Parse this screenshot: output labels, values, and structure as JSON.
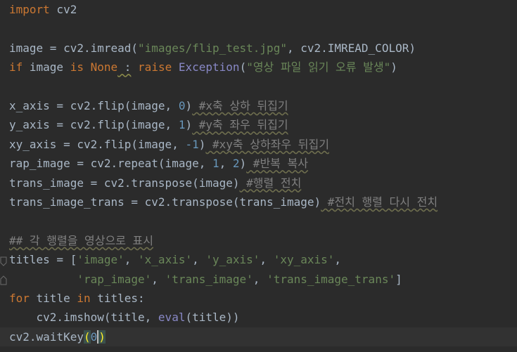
{
  "editor": {
    "lines": [
      {
        "tokens": [
          {
            "t": "import",
            "c": "kw"
          },
          {
            "t": " cv2",
            "c": ""
          }
        ]
      },
      {
        "tokens": []
      },
      {
        "tokens": [
          {
            "t": "image = cv2.imread(",
            "c": ""
          },
          {
            "t": "\"images/flip_test.jpg\"",
            "c": "str"
          },
          {
            "t": ", cv2.IMREAD_COLOR)",
            "c": ""
          }
        ]
      },
      {
        "tokens": [
          {
            "t": "if",
            "c": "kw"
          },
          {
            "t": " image ",
            "c": ""
          },
          {
            "t": "is",
            "c": "kw"
          },
          {
            "t": " ",
            "c": ""
          },
          {
            "t": "None",
            "c": "kw"
          },
          {
            "t": " :",
            "c": "warn"
          },
          {
            "t": " ",
            "c": ""
          },
          {
            "t": "raise",
            "c": "kw"
          },
          {
            "t": " ",
            "c": ""
          },
          {
            "t": "Exception",
            "c": "cls"
          },
          {
            "t": "(",
            "c": ""
          },
          {
            "t": "\"영상 파일 읽기 오류 발생\"",
            "c": "str"
          },
          {
            "t": ")",
            "c": ""
          }
        ]
      },
      {
        "tokens": []
      },
      {
        "tokens": [
          {
            "t": "x_axis = cv2.flip(image, ",
            "c": ""
          },
          {
            "t": "0",
            "c": "num"
          },
          {
            "t": ")",
            "c": ""
          },
          {
            "t": " #x축 상하 뒤집기",
            "c": "cmt"
          }
        ]
      },
      {
        "tokens": [
          {
            "t": "y_axis = cv2.flip(image, ",
            "c": ""
          },
          {
            "t": "1",
            "c": "num"
          },
          {
            "t": ")",
            "c": ""
          },
          {
            "t": " #y축 좌우 뒤집기",
            "c": "cmt"
          }
        ]
      },
      {
        "tokens": [
          {
            "t": "xy_axis = cv2.flip(image, ",
            "c": ""
          },
          {
            "t": "-1",
            "c": "num"
          },
          {
            "t": ")",
            "c": ""
          },
          {
            "t": " #xy축 상하좌우 뒤집기",
            "c": "cmt"
          }
        ]
      },
      {
        "tokens": [
          {
            "t": "rap_image = cv2.repeat(image, ",
            "c": ""
          },
          {
            "t": "1",
            "c": "num"
          },
          {
            "t": ", ",
            "c": ""
          },
          {
            "t": "2",
            "c": "num"
          },
          {
            "t": ")",
            "c": ""
          },
          {
            "t": " #반복 복사",
            "c": "cmt"
          }
        ]
      },
      {
        "tokens": [
          {
            "t": "trans_image = cv2.transpose(image)",
            "c": ""
          },
          {
            "t": " #행렬 전치",
            "c": "cmt"
          }
        ]
      },
      {
        "tokens": [
          {
            "t": "trans_image_trans = cv2.transpose(trans_image)",
            "c": ""
          },
          {
            "t": " #전치 행렬 다시 전치",
            "c": "cmt"
          }
        ]
      },
      {
        "tokens": []
      },
      {
        "tokens": [
          {
            "t": "## 각 행렬을 영상으로 표시",
            "c": "cmt"
          }
        ]
      },
      {
        "tokens": [
          {
            "t": "titles = [",
            "c": ""
          },
          {
            "t": "'image'",
            "c": "str"
          },
          {
            "t": ", ",
            "c": ""
          },
          {
            "t": "'x_axis'",
            "c": "str"
          },
          {
            "t": ", ",
            "c": ""
          },
          {
            "t": "'y_axis'",
            "c": "str"
          },
          {
            "t": ", ",
            "c": ""
          },
          {
            "t": "'xy_axis'",
            "c": "str"
          },
          {
            "t": ",",
            "c": ""
          }
        ]
      },
      {
        "tokens": [
          {
            "t": "          ",
            "c": ""
          },
          {
            "t": "'rap_image'",
            "c": "str"
          },
          {
            "t": ", ",
            "c": ""
          },
          {
            "t": "'trans_image'",
            "c": "str"
          },
          {
            "t": ", ",
            "c": ""
          },
          {
            "t": "'trans_image_trans'",
            "c": "str"
          },
          {
            "t": "]",
            "c": ""
          }
        ]
      },
      {
        "tokens": [
          {
            "t": "for",
            "c": "kw"
          },
          {
            "t": " title ",
            "c": ""
          },
          {
            "t": "in",
            "c": "kw"
          },
          {
            "t": " titles:",
            "c": ""
          }
        ]
      },
      {
        "tokens": [
          {
            "t": "    cv2.imshow(title, ",
            "c": ""
          },
          {
            "t": "eval",
            "c": "bi"
          },
          {
            "t": "(title))",
            "c": ""
          }
        ]
      },
      {
        "tokens": [
          {
            "t": "cv2.waitKey",
            "c": ""
          },
          {
            "t": "(",
            "c": "brace-match"
          },
          {
            "t": "0",
            "c": "num"
          },
          {
            "t": "CARET",
            "c": "caret"
          },
          {
            "t": ")",
            "c": "brace-match"
          }
        ]
      }
    ],
    "current_line": 17,
    "colors": {
      "background": "#2b2b2b",
      "keyword": "#cc7832",
      "string": "#6a8759",
      "number": "#6897bb",
      "comment": "#808080",
      "text": "#a9b7c6"
    }
  }
}
